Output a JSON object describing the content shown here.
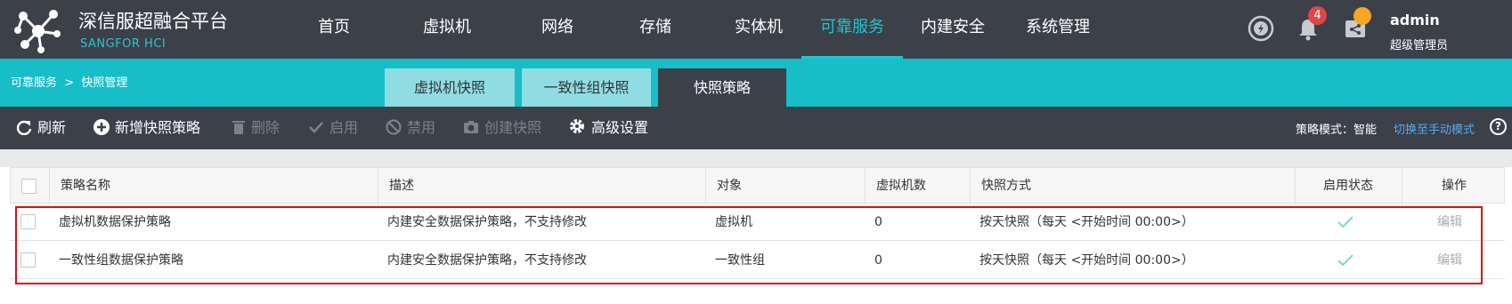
{
  "brand": {
    "title": "深信服超融合平台",
    "subtitle": "SANGFOR HCI"
  },
  "nav": [
    {
      "label": "首页"
    },
    {
      "label": "虚拟机"
    },
    {
      "label": "网络"
    },
    {
      "label": "存储"
    },
    {
      "label": "实体机"
    },
    {
      "label": "可靠服务",
      "active": true
    },
    {
      "label": "内建安全"
    },
    {
      "label": "系统管理"
    }
  ],
  "header": {
    "notification_count": "4",
    "user_name": "admin",
    "user_role": "超级管理员"
  },
  "breadcrumb": "可靠服务  >  快照管理",
  "tabs": [
    {
      "label": "虚拟机快照"
    },
    {
      "label": "一致性组快照"
    },
    {
      "label": "快照策略",
      "active": true
    }
  ],
  "toolbar": {
    "refresh": "刷新",
    "add_policy": "新增快照策略",
    "delete": "删除",
    "enable": "启用",
    "disable": "禁用",
    "create_snapshot": "创建快照",
    "advanced": "高级设置",
    "mode_label": "策略模式：智能",
    "mode_link": "切换至手动模式"
  },
  "table": {
    "columns": [
      "策略名称",
      "描述",
      "对象",
      "虚拟机数",
      "快照方式",
      "启用状态",
      "操作"
    ],
    "rows": [
      {
        "name": "虚拟机数据保护策略",
        "description": "内建安全数据保护策略，不支持修改",
        "object": "虚拟机",
        "vm_count": "0",
        "method": "按天快照（每天 <开始时间 00:00>）",
        "enabled": true,
        "action": "编辑"
      },
      {
        "name": "一致性组数据保护策略",
        "description": "内建安全数据保护策略，不支持修改",
        "object": "一致性组",
        "vm_count": "0",
        "method": "按天快照（每天 <开始时间 00:00>）",
        "enabled": true,
        "action": "编辑"
      }
    ]
  },
  "colors": {
    "header_bg": "#3b4049",
    "teal": "#18bec7",
    "active_nav": "#25c3cc",
    "badge": "#e04646",
    "highlight_border": "#e30b0b",
    "check": "#7fd8c0"
  }
}
